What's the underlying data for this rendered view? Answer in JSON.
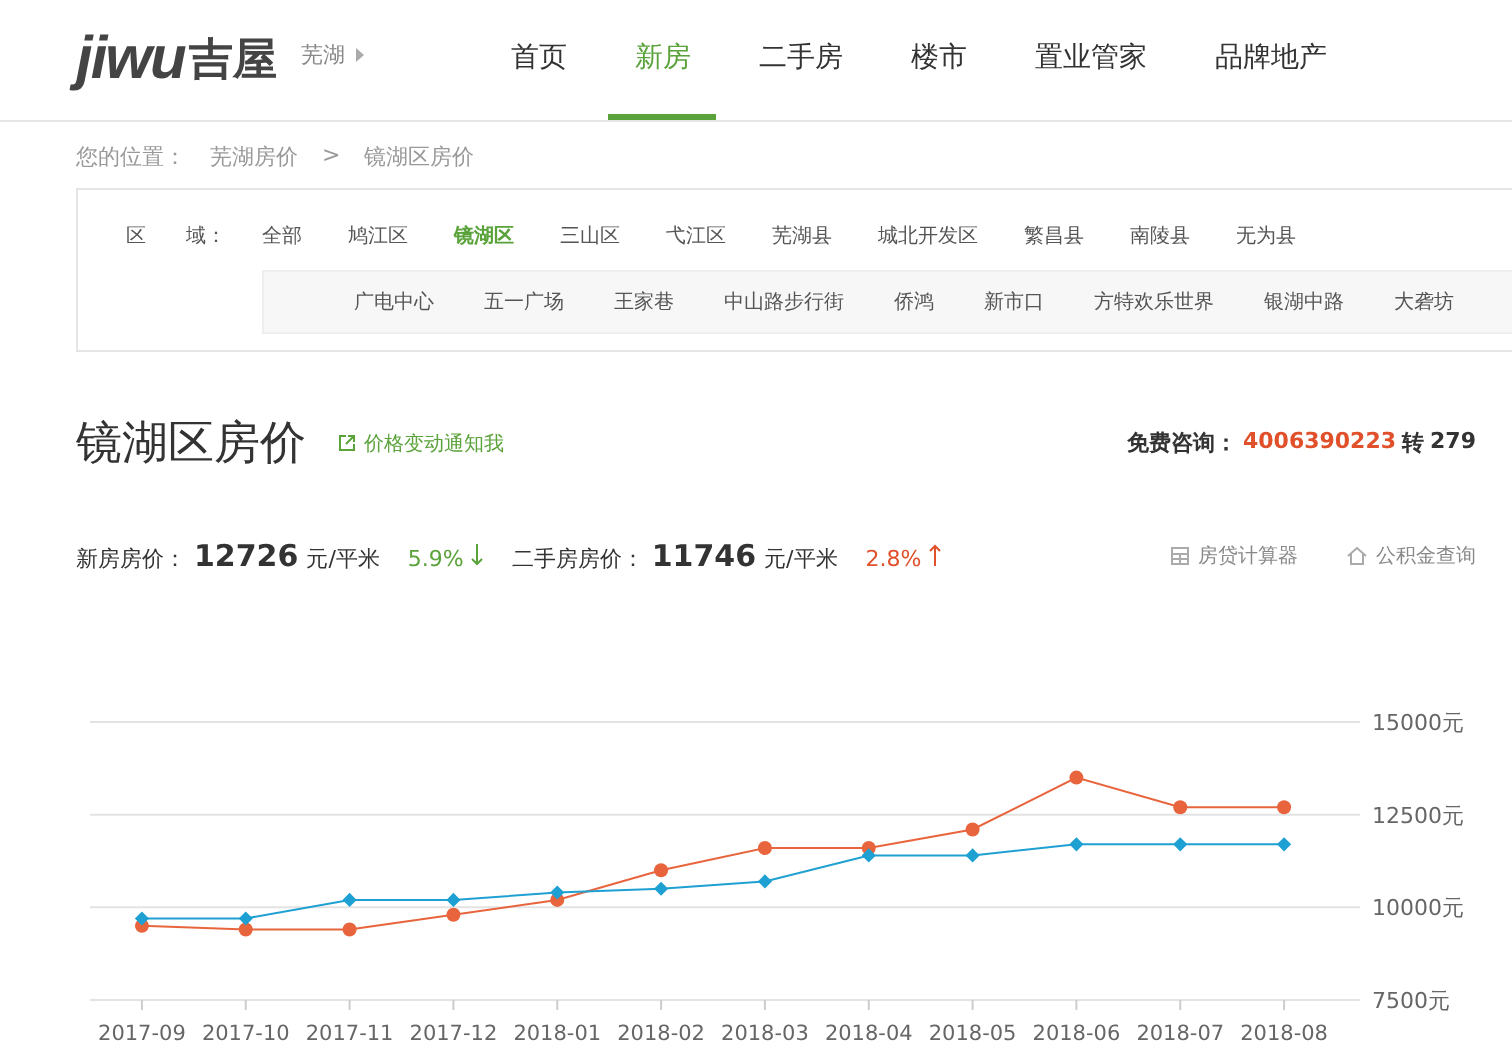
{
  "header": {
    "logo_latin": "jiwu",
    "logo_cn": "吉屋",
    "city": "芜湖",
    "nav": [
      {
        "label": "首页",
        "selected": false
      },
      {
        "label": "新房",
        "selected": true
      },
      {
        "label": "二手房",
        "selected": false
      },
      {
        "label": "楼市",
        "selected": false
      },
      {
        "label": "置业管家",
        "selected": false
      },
      {
        "label": "品牌地产",
        "selected": false
      }
    ]
  },
  "breadcrumb": {
    "prefix": "您的位置：",
    "items": [
      "芜湖房价",
      "镜湖区房价"
    ],
    "separator": ">"
  },
  "filter": {
    "label": "区　　域：",
    "districts": [
      {
        "label": "全部",
        "selected": false
      },
      {
        "label": "鸠江区",
        "selected": false
      },
      {
        "label": "镜湖区",
        "selected": true
      },
      {
        "label": "三山区",
        "selected": false
      },
      {
        "label": "弋江区",
        "selected": false
      },
      {
        "label": "芜湖县",
        "selected": false
      },
      {
        "label": "城北开发区",
        "selected": false
      },
      {
        "label": "繁昌县",
        "selected": false
      },
      {
        "label": "南陵县",
        "selected": false
      },
      {
        "label": "无为县",
        "selected": false
      }
    ],
    "areas": [
      "广电中心",
      "五一广场",
      "王家巷",
      "中山路步行街",
      "侨鸿",
      "新市口",
      "方特欢乐世界",
      "银湖中路",
      "大砻坊"
    ]
  },
  "title": {
    "text": "镜湖区房价",
    "notify": "价格变动通知我",
    "hotline_label": "免费咨询：",
    "hotline_number": "4006390223",
    "ext_label": "转",
    "ext": "279"
  },
  "stats": [
    {
      "label": "新房房价：",
      "value": "12726",
      "unit": "元/平米",
      "change": "5.9%",
      "rising": false
    },
    {
      "label": "二手房房价：",
      "value": "11746",
      "unit": "元/平米",
      "change": "2.8%",
      "rising": true
    }
  ],
  "tools": [
    {
      "kind": "calculator",
      "label": "房贷计算器"
    },
    {
      "kind": "home",
      "label": "公积金查询"
    }
  ],
  "chart_data": {
    "type": "line",
    "categories": [
      "2017-09",
      "2017-10",
      "2017-11",
      "2017-12",
      "2018-01",
      "2018-02",
      "2018-03",
      "2018-04",
      "2018-05",
      "2018-06",
      "2018-07",
      "2018-08"
    ],
    "series": [
      {
        "color": "#e8643c",
        "marker": "circle",
        "values": [
          9500,
          9400,
          9400,
          9800,
          10200,
          11000,
          11600,
          11600,
          12100,
          13500,
          12700,
          12700
        ]
      },
      {
        "color": "#1ea0d2",
        "marker": "diamond",
        "values": [
          9700,
          9700,
          10200,
          10200,
          10400,
          10500,
          10700,
          11400,
          11400,
          11700,
          11700,
          11700
        ]
      }
    ],
    "ylim": [
      7500,
      15000
    ],
    "yticks": [
      {
        "value": 7500,
        "label": "7500元"
      },
      {
        "value": 10000,
        "label": "10000元"
      },
      {
        "value": 12500,
        "label": "12500元"
      },
      {
        "value": 15000,
        "label": "15000元"
      }
    ]
  }
}
